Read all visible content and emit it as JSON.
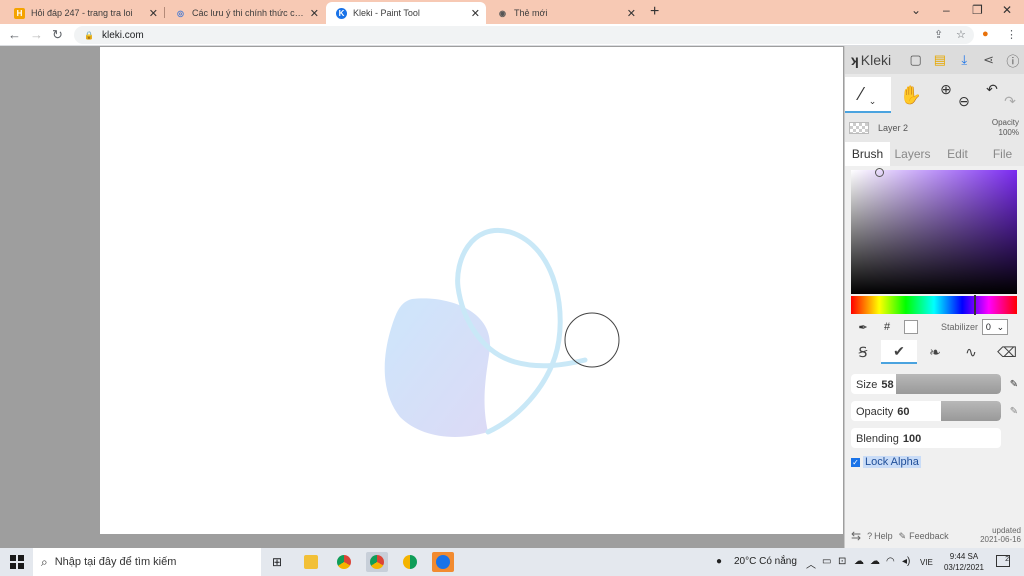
{
  "browser": {
    "tabs": [
      {
        "title": "Hỏi đáp 247 - trang tra loi",
        "favicon_color": "#f4a300",
        "favicon_glyph": "H"
      },
      {
        "title": "Các lưu ý thi chính thức cấp trườ",
        "favicon_color": "#4a7bd1",
        "favicon_glyph": "◎"
      },
      {
        "title": "Kleki - Paint Tool",
        "favicon_color": "#1a73e8",
        "favicon_glyph": "K"
      },
      {
        "title": "Thẻ mới",
        "favicon_color": "#555555",
        "favicon_glyph": "◉"
      }
    ],
    "active_tab": 2,
    "close_glyph": "✕",
    "new_tab_glyph": "+",
    "window_controls": [
      "⌄",
      "–",
      "❐",
      "✕"
    ],
    "url": "kleki.com"
  },
  "kleki": {
    "brand": "Kleki",
    "layer": {
      "name": "Layer 2",
      "opacity_label": "Opacity",
      "opacity_value": "100%"
    },
    "tabs": [
      "Brush",
      "Layers",
      "Edit",
      "File"
    ],
    "active_tab": "Brush",
    "color": {
      "hue_position": 0.74,
      "sv_cursor": [
        0.17,
        0.02
      ],
      "hash": "#"
    },
    "stabilizer": {
      "label": "Stabilizer",
      "value": "0"
    },
    "size": {
      "label": "Size",
      "value": "58",
      "fill": 0.3
    },
    "opacity": {
      "label": "Opacity",
      "value": "60",
      "fill": 0.6
    },
    "blending": {
      "label": "Blending",
      "value": "100",
      "fill": 1.0
    },
    "lock_alpha": {
      "label": "Lock Alpha",
      "checked": true
    },
    "bottom": {
      "help": "Help",
      "feedback": "Feedback",
      "updated_label": "updated",
      "updated_date": "2021-06-16"
    }
  },
  "taskbar": {
    "search_placeholder": "Nhập tại đây để tìm kiếm",
    "weather": "20°C  Có nắng",
    "language": "VIE",
    "time": "9:44 SA",
    "date": "03/12/2021",
    "notifications": "2"
  },
  "colors": {
    "tabstrip": "#f7c9b4",
    "accent": "#4aa3df",
    "stroke": "#c9e8f7",
    "fill": "#cfe3fa"
  }
}
